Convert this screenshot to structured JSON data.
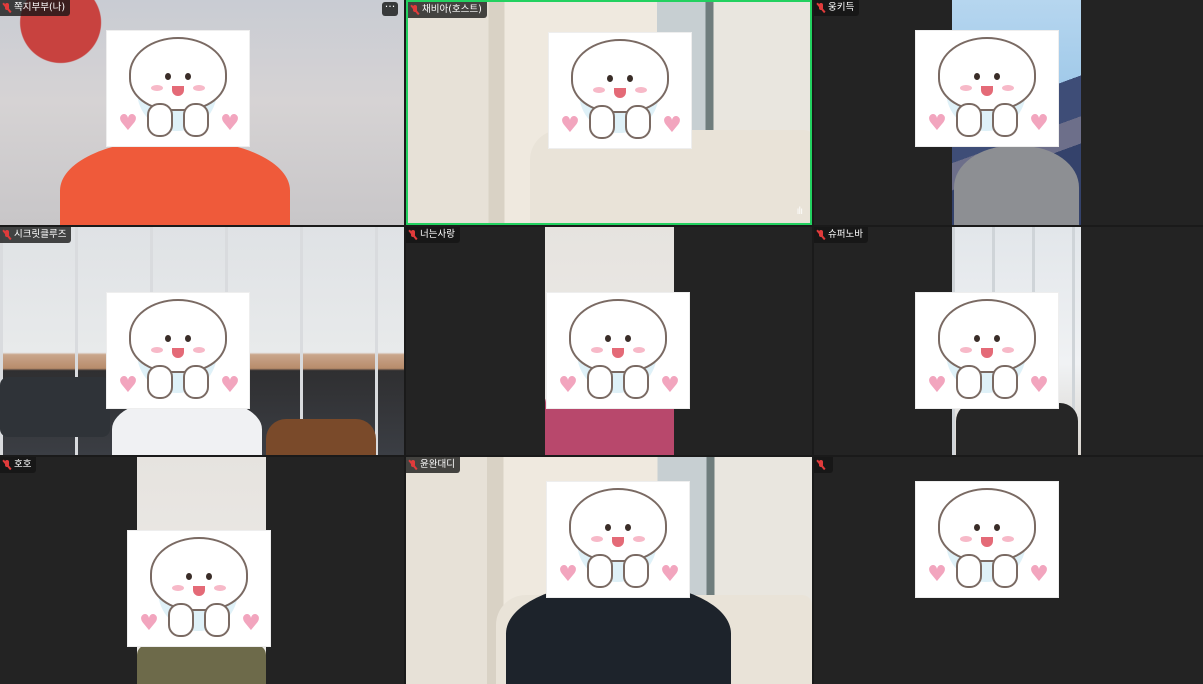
{
  "participants": [
    {
      "name": "쪽지부부(나)"
    },
    {
      "name": "채비아(호스트)"
    },
    {
      "name": "웅키득"
    },
    {
      "name": "시크릿클루즈"
    },
    {
      "name": "너는사랑"
    },
    {
      "name": "슈퍼노바"
    },
    {
      "name": "호호"
    },
    {
      "name": "윤완대디"
    },
    {
      "name": ""
    }
  ],
  "tile_menu": {
    "more_label": "···"
  },
  "active_speaker_audio_icon": "audio-wave-icon",
  "colors": {
    "active_border": "#23d160",
    "label_bg": "#141414",
    "mic_muted": "#e03b3b",
    "tile_bg": "#232323"
  },
  "avatar_sticker": {
    "icon": "puppy-sticker-icon",
    "heart_glyph": "♥"
  }
}
